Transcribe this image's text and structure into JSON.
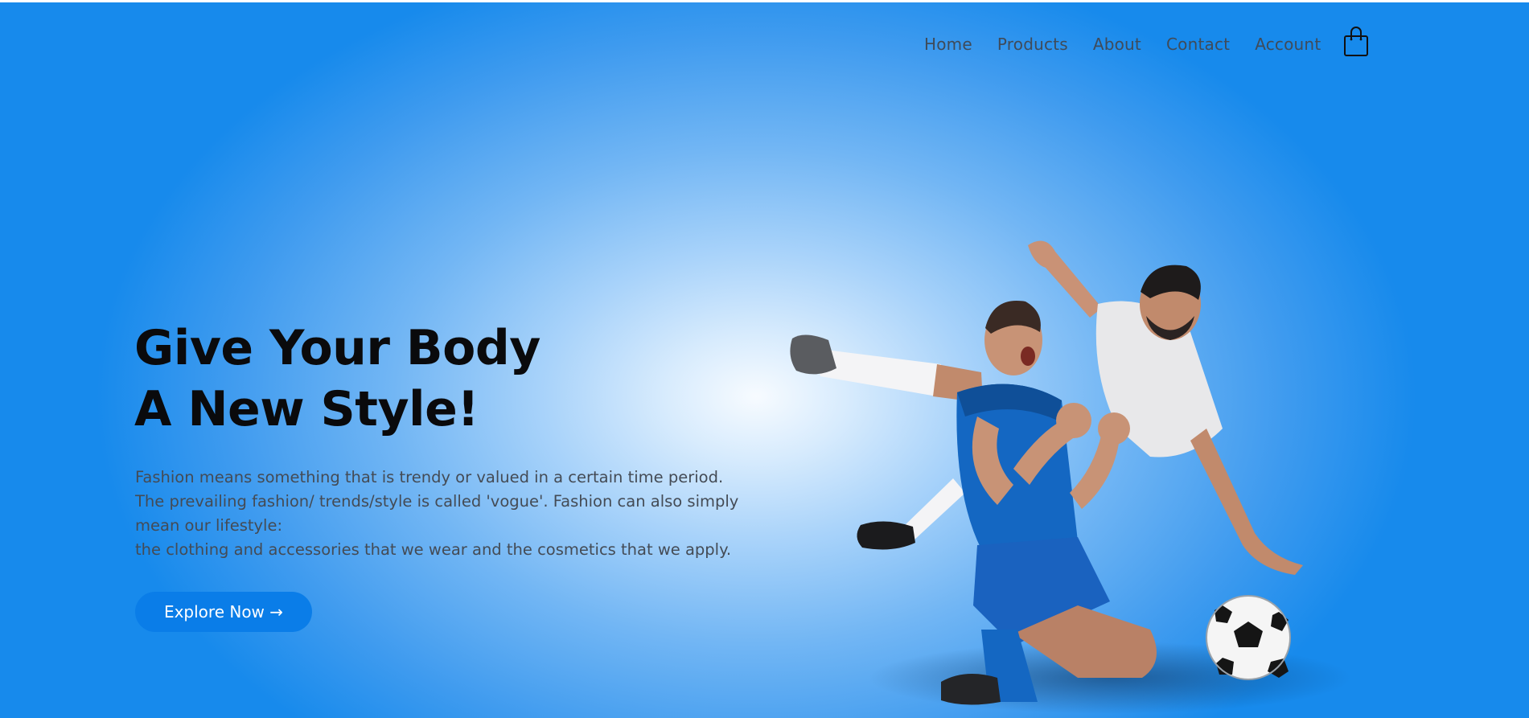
{
  "nav": {
    "items": [
      {
        "label": "Home"
      },
      {
        "label": "Products"
      },
      {
        "label": "About"
      },
      {
        "label": "Contact"
      },
      {
        "label": "Account"
      }
    ],
    "cart_icon": "shopping-bag-icon"
  },
  "hero": {
    "headline_line1": "Give Your Body",
    "headline_line2": "A New Style!",
    "description_lines": [
      "Fashion means something that is trendy or valued in a certain time period.",
      "The prevailing fashion/ trends/style is called 'vogue'. Fashion can also simply",
      "mean our lifestyle:",
      "the clothing and accessories that we wear and the cosmetics that we apply."
    ],
    "cta_label": "Explore Now →",
    "illustration": "two-football-players-celebrating-image"
  },
  "colors": {
    "accent": "#0a7de8",
    "background_edge": "#178aec",
    "background_center": "#f7fbff",
    "headline": "#0a0a0c",
    "body_text": "#444b55"
  }
}
